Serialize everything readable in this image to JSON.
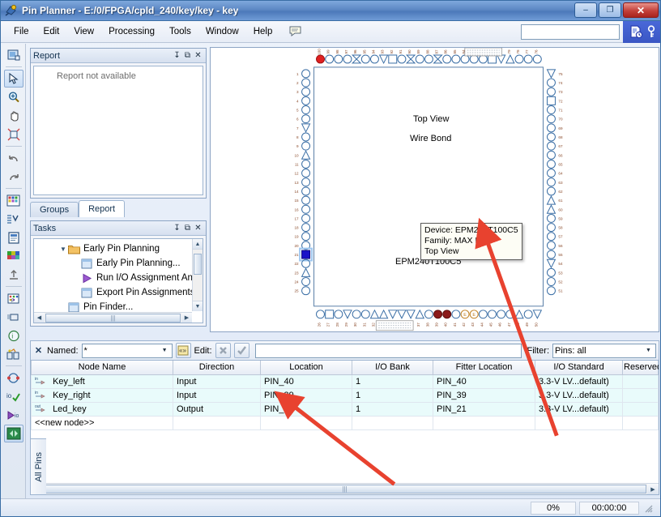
{
  "window": {
    "title": "Pin Planner - E:/0/FPGA/cpld_240/key/key - key",
    "app_icon": "pin-planner-icon",
    "minimize_label": "–",
    "restore_label": "❐",
    "close_label": "✕"
  },
  "menu": {
    "items": [
      {
        "label": "File"
      },
      {
        "label": "Edit"
      },
      {
        "label": "View"
      },
      {
        "label": "Processing"
      },
      {
        "label": "Tools"
      },
      {
        "label": "Window"
      },
      {
        "label": "Help"
      }
    ],
    "note_icon": "message-note-icon",
    "search_value": "",
    "search_placeholder": ""
  },
  "blue_panel": {
    "icons": [
      "history-document-icon",
      "key-icon"
    ]
  },
  "left_toolbar": {
    "items": [
      {
        "name": "package-view-icon",
        "selected": false
      },
      {
        "name": "pointer-select-icon",
        "selected": true
      },
      {
        "name": "zoom-icon",
        "selected": false
      },
      {
        "name": "pan-hand-icon",
        "selected": false
      },
      {
        "name": "fit-in-window-icon",
        "selected": false
      },
      {
        "name": "undo-icon",
        "selected": false
      },
      {
        "name": "redo-icon",
        "selected": false
      },
      {
        "name": "pin-legend-icon",
        "selected": false
      },
      {
        "name": "report-table-icon",
        "selected": false
      },
      {
        "name": "properties-icon",
        "selected": false
      },
      {
        "name": "pad-view-icon",
        "selected": false
      },
      {
        "name": "export-icon",
        "selected": false
      },
      {
        "name": "pin-migration-icon",
        "selected": false
      },
      {
        "name": "live-io-check-icon",
        "selected": false
      },
      {
        "name": "io-assignment-warnings-icon",
        "selected": false
      },
      {
        "name": "dual-purpose-pins-icon",
        "selected": false
      },
      {
        "name": "io-bank-icon",
        "selected": false
      },
      {
        "name": "io-check-icon",
        "selected": false
      },
      {
        "name": "run-io-assignment-icon",
        "selected": false
      },
      {
        "name": "pin-finder-icon",
        "selected": true
      }
    ]
  },
  "report_panel": {
    "title": "Report",
    "message": "Report not available",
    "pin_label": "↧",
    "float_label": "⧉",
    "close_label": "✕"
  },
  "panel_tabs": [
    {
      "label": "Groups",
      "active": false
    },
    {
      "label": "Report",
      "active": true
    }
  ],
  "tasks_panel": {
    "title": "Tasks",
    "pin_label": "↧",
    "float_label": "⧉",
    "close_label": "✕",
    "tree": [
      {
        "label": "Early Pin Planning",
        "icon": "folder-icon",
        "indent": 1,
        "expander": "▼"
      },
      {
        "label": "Early Pin Planning...",
        "icon": "task-page-icon",
        "indent": 2,
        "expander": ""
      },
      {
        "label": "Run I/O Assignment An",
        "icon": "run-play-icon",
        "indent": 2,
        "expander": ""
      },
      {
        "label": "Export Pin Assignments",
        "icon": "task-page-icon",
        "indent": 2,
        "expander": ""
      },
      {
        "label": "Pin Finder...",
        "icon": "task-page-icon",
        "indent": 1,
        "expander": ""
      }
    ]
  },
  "package_view": {
    "top_view_label": "Top View",
    "wire_bond_label": "Wire Bond",
    "device_label": "EPM240T100C5",
    "tooltip": {
      "device": "Device: EPM240T100C5",
      "family": "Family: MAX II",
      "view": "Top View"
    }
  },
  "filter_bar": {
    "close_label": "✕",
    "named_label": "Named:",
    "named_value": "*",
    "named_caret": "▼",
    "wildcard_icon": "wildcard-icon",
    "edit_label": "Edit:",
    "cancel_icon": "x-cancel-icon",
    "accept_icon": "check-accept-icon",
    "edit_value": "",
    "filter_label": "Filter:",
    "filter_value": "Pins: all",
    "filter_caret": "▼"
  },
  "pin_table": {
    "columns": [
      "Node Name",
      "Direction",
      "Location",
      "I/O Bank",
      "Fitter Location",
      "I/O Standard",
      "Reserved"
    ],
    "rows": [
      {
        "icon": "input-pin-icon",
        "node_name": "Key_left",
        "direction": "Input",
        "location": "PIN_40",
        "io_bank": "1",
        "fitter_location": "PIN_40",
        "io_standard": "3.3-V LV...default)",
        "reserved": ""
      },
      {
        "icon": "input-pin-icon",
        "node_name": "Key_right",
        "direction": "Input",
        "location": "PIN_39",
        "io_bank": "1",
        "fitter_location": "PIN_39",
        "io_standard": "3.3-V LV...default)",
        "reserved": ""
      },
      {
        "icon": "output-pin-icon",
        "node_name": "Led_key",
        "direction": "Output",
        "location": "PIN_21",
        "io_bank": "1",
        "fitter_location": "PIN_21",
        "io_standard": "3.3-V LV...default)",
        "reserved": ""
      }
    ],
    "new_node_label": "<<new node>>"
  },
  "all_pins_tab": {
    "label": "All Pins"
  },
  "status_bar": {
    "progress": "0%",
    "time": "00:00:00"
  },
  "colors": {
    "titlebar": "#5d88c4",
    "close_button": "#c3403a",
    "selected_pin": "#1a12c8",
    "assigned_pin": "#8b1a1a",
    "highlight_pin": "#e02020",
    "table_row": "#e9fbfb",
    "annotation_arrow": "#e8422f"
  },
  "annotations": [
    {
      "name": "arrow-to-tooltip"
    },
    {
      "name": "arrow-to-location-cell"
    }
  ]
}
